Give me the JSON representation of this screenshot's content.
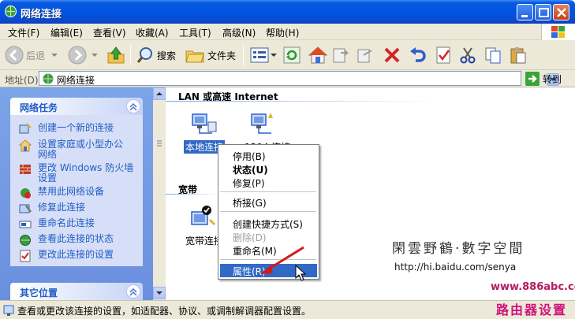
{
  "window": {
    "title": "网络连接"
  },
  "menubar": {
    "items": [
      "文件(F)",
      "编辑(E)",
      "查看(V)",
      "收藏(A)",
      "工具(T)",
      "高级(N)",
      "帮助(H)"
    ]
  },
  "toolbar": {
    "back_label": "后退",
    "search_label": "搜索",
    "folders_label": "文件夹"
  },
  "address": {
    "label": "地址(D)",
    "value": "网络连接",
    "go_label": "转到"
  },
  "left_pane": {
    "network_tasks": {
      "title": "网络任务",
      "items": [
        {
          "label": "创建一个新的连接"
        },
        {
          "label": "设置家庭或小型办公",
          "label2": "网络"
        },
        {
          "label": "更改 Windows 防火墙",
          "label2": "设置"
        },
        {
          "label": "禁用此网络设备"
        },
        {
          "label": "修复此连接"
        },
        {
          "label": "重命名此连接"
        },
        {
          "label": "查看此连接的状态"
        },
        {
          "label": "更改此连接的设置"
        }
      ]
    },
    "other_places": {
      "title": "其它位置"
    }
  },
  "content": {
    "group_lan": "LAN 或高速 Internet",
    "group_broadband": "宽带",
    "items": {
      "local": "本地连接",
      "conn1394": "1394 连接",
      "broadband": "宽带连接"
    }
  },
  "context_menu": {
    "items": {
      "disable": "停用(B)",
      "status": "状态(U)",
      "repair": "修复(P)",
      "bridge": "桥接(G)",
      "shortcut": "创建快捷方式(S)",
      "delete": "删除(D)",
      "rename": "重命名(M)",
      "properties": "属性(R)"
    }
  },
  "statusbar": {
    "text": "查看或更改该连接的设置，如适配器、协议、或调制解调器配置设置。"
  },
  "watermark": {
    "text": "閑雲野鶴·數字空間",
    "url": "http://hi.baidu.com/senya",
    "site": "www.886abc.com",
    "brand": "路由器设置"
  },
  "colors": {
    "titlebar": "#0054e3",
    "task_link": "#215dc6",
    "selection": "#316ac5",
    "pane_bg": "#6b8fdf"
  }
}
